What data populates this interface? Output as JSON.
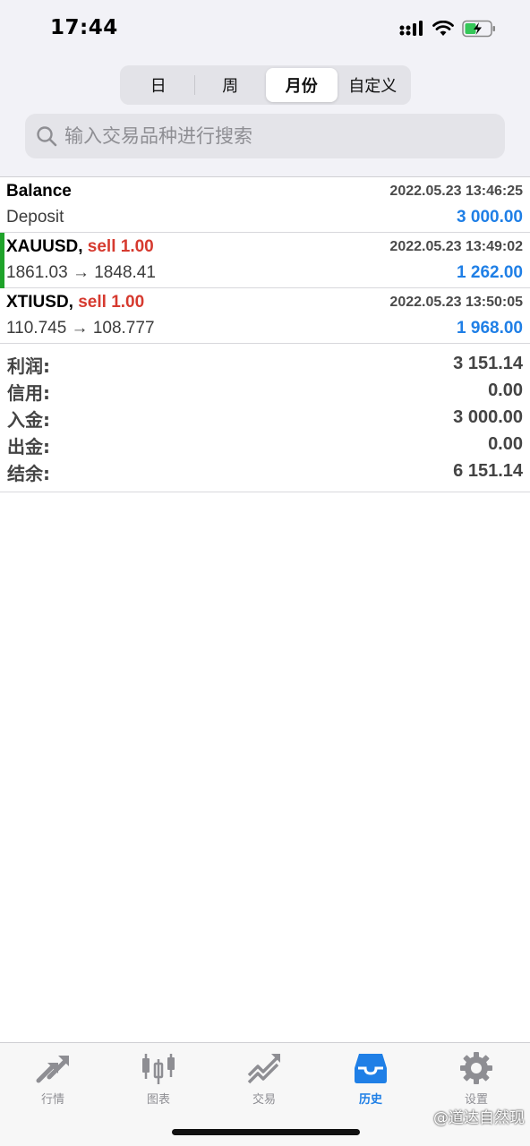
{
  "status": {
    "time": "17:44"
  },
  "segments": [
    {
      "label": "日"
    },
    {
      "label": "周"
    },
    {
      "label": "月份",
      "active": true
    },
    {
      "label": "自定义"
    }
  ],
  "search": {
    "placeholder": "输入交易品种进行搜索",
    "value": ""
  },
  "rows": [
    {
      "title": "Balance",
      "side": "",
      "date": "2022.05.23 13:46:25",
      "detail": "Deposit",
      "amount": "3 000.00"
    },
    {
      "title": "XAUUSD,",
      "side": " sell 1.00",
      "date": "2022.05.23 13:49:02",
      "detail": "1861.03 → 1848.41",
      "amount": "1 262.00"
    },
    {
      "title": "XTIUSD,",
      "side": " sell 1.00",
      "date": "2022.05.23 13:50:05",
      "detail": "110.745 → 108.777",
      "amount": "1 968.00"
    }
  ],
  "summary": [
    {
      "label": "利润:",
      "value": "3 151.14"
    },
    {
      "label": "信用:",
      "value": "0.00"
    },
    {
      "label": "入金:",
      "value": "3 000.00"
    },
    {
      "label": "出金:",
      "value": "0.00"
    },
    {
      "label": "结余:",
      "value": "6 151.14"
    }
  ],
  "tabs": [
    {
      "label": "行情",
      "icon": "quotes-arrows-icon"
    },
    {
      "label": "图表",
      "icon": "candlestick-icon"
    },
    {
      "label": "交易",
      "icon": "trade-chart-icon"
    },
    {
      "label": "历史",
      "icon": "inbox-tray-icon",
      "active": true
    },
    {
      "label": "设置",
      "icon": "gear-icon"
    }
  ],
  "watermark": "@道达自然现",
  "colors": {
    "accent": "#1f7fe6",
    "sell": "#d63a2f",
    "open_marker": "#1fa32a"
  }
}
